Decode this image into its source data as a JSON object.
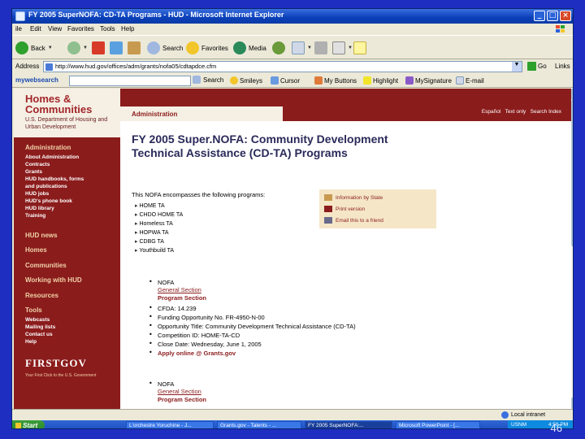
{
  "window": {
    "title": "FY 2005 SuperNOFA: CD-TA Programs - HUD - Microsoft Internet Explorer",
    "controls": [
      "_",
      "□",
      "×"
    ]
  },
  "menu": [
    "ile",
    "Edit",
    "View",
    "Favorites",
    "Tools",
    "Help"
  ],
  "toolbar": {
    "back": "Back",
    "search": "Search",
    "favorites": "Favorites",
    "media": "Media"
  },
  "address": {
    "label": "Address",
    "url": "http://www.hud.gov/offices/adm/grants/nofa05/cdtapdce.cfm",
    "go": "Go",
    "links": "Links"
  },
  "searchbar": {
    "logo": "mywebsearch",
    "search": "Search",
    "smileys": "Smileys",
    "cursor": "Cursor",
    "mybuttons": "My Buttons",
    "highlight": "Highlight",
    "mysignature": "MySignature",
    "email": "E-mail"
  },
  "sidebar": {
    "logo_title": "Homes &\nCommunities",
    "logo_sub": "U.S. Department of Housing and Urban Development",
    "admin_head": "Administration",
    "admin_links": [
      "About Administration",
      "Contracts",
      "Grants",
      "HUD handbooks, forms",
      "and publications",
      "HUD jobs",
      "HUD's phone book",
      "HUD library",
      "Training"
    ],
    "sections": [
      "HUD news",
      "Homes",
      "Communities",
      "Working with HUD",
      "Resources",
      "Tools"
    ],
    "tools_links": [
      "Webcasts",
      "Mailing lists",
      "Contact us",
      "Help"
    ],
    "firstgov": "FIRSTGOV",
    "firstgov_tag": "Your First Click to the U.S. Government"
  },
  "header": {
    "tab": "Administration",
    "links": "Español   Text only   Search Index"
  },
  "content": {
    "title": "FY 2005 Super.NOFA: Community Development Technical Assistance (CD-TA) Programs",
    "intro": "This NOFA encompasses the following programs:",
    "programs": [
      "HOME TA",
      "CHDO HOME TA",
      "Homeless TA",
      "HOPWA TA",
      "CDBG TA",
      "Youthbuild TA"
    ],
    "info": [
      "Information by State",
      "Print version",
      "Email this to a friend"
    ],
    "nofa1": {
      "label": "NOFA",
      "general": "General Section",
      "program": "Program Section",
      "cfda": "CFDA: 14.239",
      "funding": "Funding Opportunity No. FR-4950-N-00",
      "opportunity": "Opportunity Title: Community Development Technical Assistance (CD-TA)",
      "competition": "Competition ID: HOME-TA-CD",
      "close": "Close Date: Wednesday, June 1, 2005",
      "apply": "Apply online @ Grants.gov"
    },
    "nofa2": {
      "label": "NOFA",
      "general": "General Section",
      "program": "Program Section"
    }
  },
  "status": {
    "zone": "Local intranet"
  },
  "taskbar": {
    "start": "Start",
    "tasks": [
      "L'orchestre Yoruchine - J...",
      "Grants.gov - Talents - ...",
      "FY 2005 SuperNOFA:...",
      "Microsoft PowerPoint - [..."
    ],
    "tray": "USNM",
    "clock": "4:56 PM"
  },
  "slide_number": "46"
}
